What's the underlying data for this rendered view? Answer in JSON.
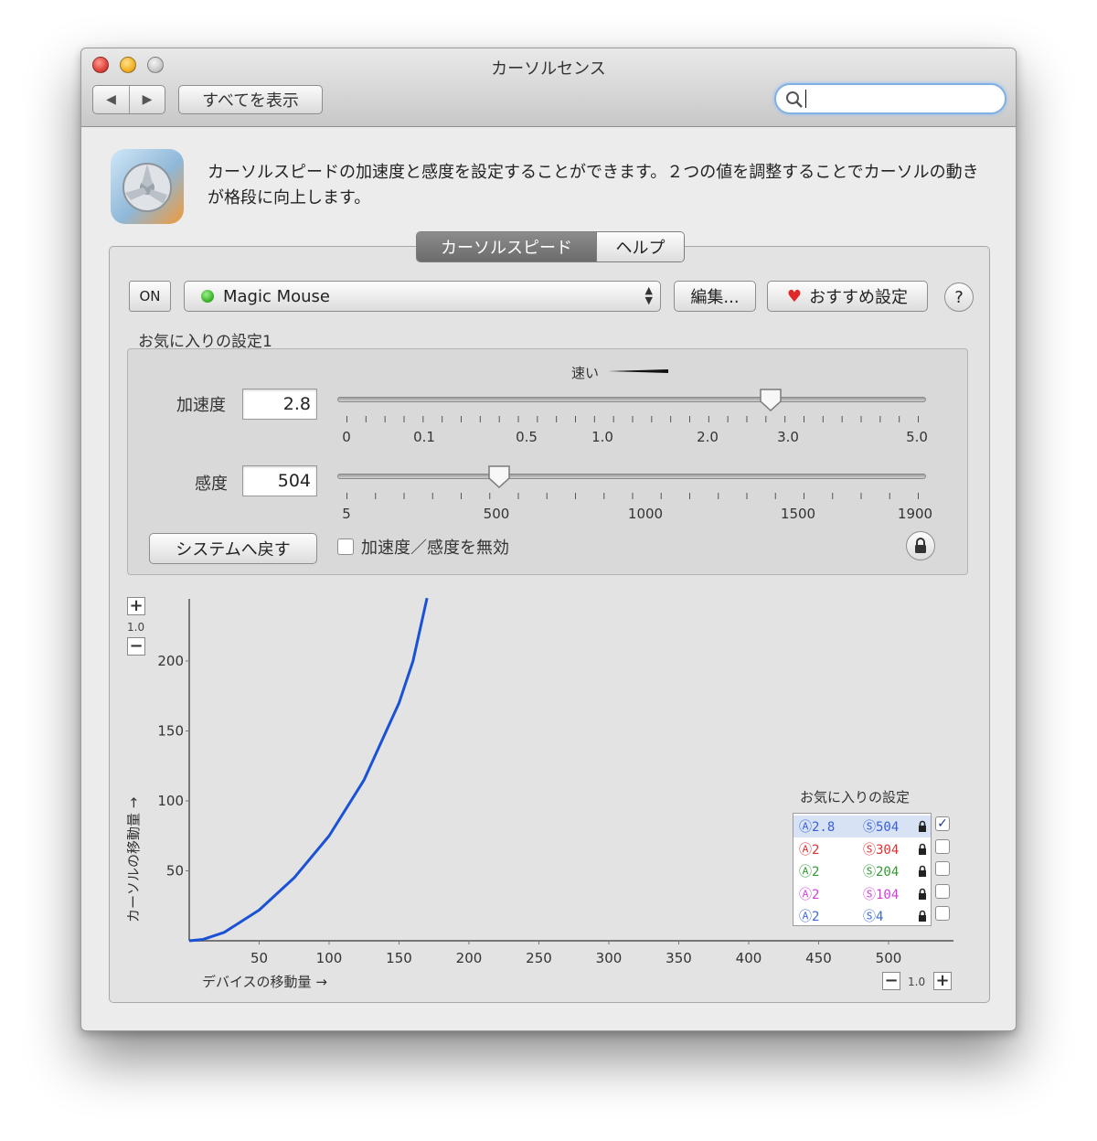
{
  "window": {
    "title": "カーソルセンス"
  },
  "toolbar": {
    "back_label": "◀",
    "forward_label": "▶",
    "show_all_label": "すべてを表示",
    "search_placeholder": ""
  },
  "header": {
    "description": "カーソルスピードの加速度と感度を設定することができます。２つの値を調整することでカーソルの動きが格段に向上します。"
  },
  "tabs": [
    {
      "label": "カーソルスピード",
      "active": true
    },
    {
      "label": "ヘルプ",
      "active": false
    }
  ],
  "controls": {
    "on_label": "ON",
    "device": "Magic Mouse",
    "edit_label": "編集...",
    "recommend_label": "おすすめ設定",
    "help_label": "?",
    "favorite_name": "お気に入りの設定1",
    "fast_label": "速い"
  },
  "acceleration": {
    "label": "加速度",
    "value": "2.8",
    "slider_fraction": 0.74,
    "tick_labels": [
      "0",
      "0.1",
      "0.5",
      "1.0",
      "2.0",
      "3.0",
      "5.0"
    ]
  },
  "sensitivity": {
    "label": "感度",
    "value": "504",
    "slider_fraction": 0.27,
    "tick_labels": [
      "5",
      "500",
      "1000",
      "1500",
      "1900"
    ]
  },
  "actions": {
    "reset_label": "システムへ戻す",
    "disable_label": "加速度／感度を無効"
  },
  "graph": {
    "y_zoom": "1.0",
    "x_zoom": "1.0",
    "y_axis_label": "カーソルの移動量 →",
    "x_axis_label": "デバイスの移動量 →",
    "curve_color": "#1a52d6"
  },
  "chart_data": {
    "type": "line",
    "xlabel": "デバイスの移動量 →",
    "ylabel": "カーソルの移動量 →",
    "xlim": [
      0,
      540
    ],
    "ylim": [
      0,
      245
    ],
    "x_ticks": [
      50,
      100,
      150,
      200,
      250,
      300,
      350,
      400,
      450,
      500
    ],
    "y_ticks": [
      50,
      100,
      150,
      200
    ],
    "series": [
      {
        "x": [
          0,
          10,
          25,
          50,
          75,
          100,
          125,
          150,
          160,
          170
        ],
        "y": [
          0,
          1,
          6,
          22,
          45,
          75,
          115,
          170,
          200,
          245
        ]
      }
    ]
  },
  "favorites": {
    "title": "お気に入りの設定",
    "items": [
      {
        "a": "Ⓐ2.8",
        "s": "Ⓢ504",
        "color": "#3a5fd8",
        "checked": true
      },
      {
        "a": "Ⓐ2",
        "s": "Ⓢ304",
        "color": "#e03030",
        "checked": false
      },
      {
        "a": "Ⓐ2",
        "s": "Ⓢ204",
        "color": "#2f9a2f",
        "checked": false
      },
      {
        "a": "Ⓐ2",
        "s": "Ⓢ104",
        "color": "#d040d8",
        "checked": false
      },
      {
        "a": "Ⓐ2",
        "s": "Ⓢ4",
        "color": "#3a6ad8",
        "checked": false
      }
    ]
  }
}
